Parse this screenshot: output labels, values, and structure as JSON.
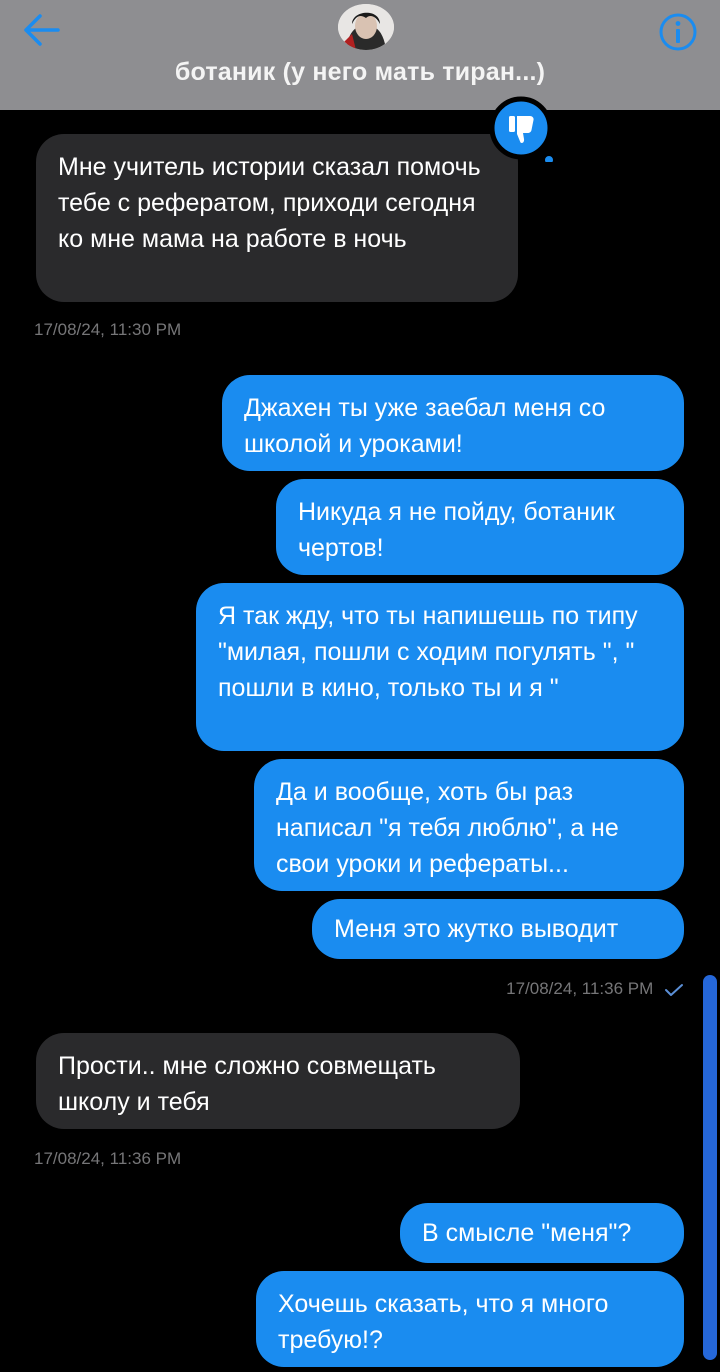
{
  "header": {
    "title": "ботаник (у него мать тиран...)",
    "back_icon": "arrow-left-icon",
    "info_icon": "info-icon",
    "accent_color": "#1a8cf0"
  },
  "messages": [
    {
      "direction": "incoming",
      "text": "Мне учитель истории сказал помочь тебе с рефератом, приходи сегодня ко мне мама на работе в ночь",
      "reaction": "thumbs-down-icon"
    },
    {
      "timestamp": "17/08/24, 11:30 PM"
    },
    {
      "direction": "outgoing",
      "text": "Джахен ты уже заебал меня со школой и уроками!"
    },
    {
      "direction": "outgoing",
      "text": "Никуда я не пойду, ботаник чертов!"
    },
    {
      "direction": "outgoing",
      "text": "Я так жду, что ты напишешь по типу \"милая, пошли с ходим погулять \", \" пошли в кино, только ты и я \""
    },
    {
      "direction": "outgoing",
      "text": "Да и вообще, хоть бы раз написал \"я тебя люблю\", а не свои уроки и рефераты..."
    },
    {
      "direction": "outgoing",
      "text": "Меня это жутко выводит"
    },
    {
      "timestamp": "17/08/24, 11:36 PM",
      "status_icon": "check-icon"
    },
    {
      "direction": "incoming",
      "text": "Прости.. мне сложно совмещать школу и тебя"
    },
    {
      "timestamp": "17/08/24, 11:36 PM"
    },
    {
      "direction": "outgoing",
      "text": "В смысле \"меня\"?"
    },
    {
      "direction": "outgoing",
      "text": "Хочешь  сказать, что я много требую!?"
    }
  ]
}
